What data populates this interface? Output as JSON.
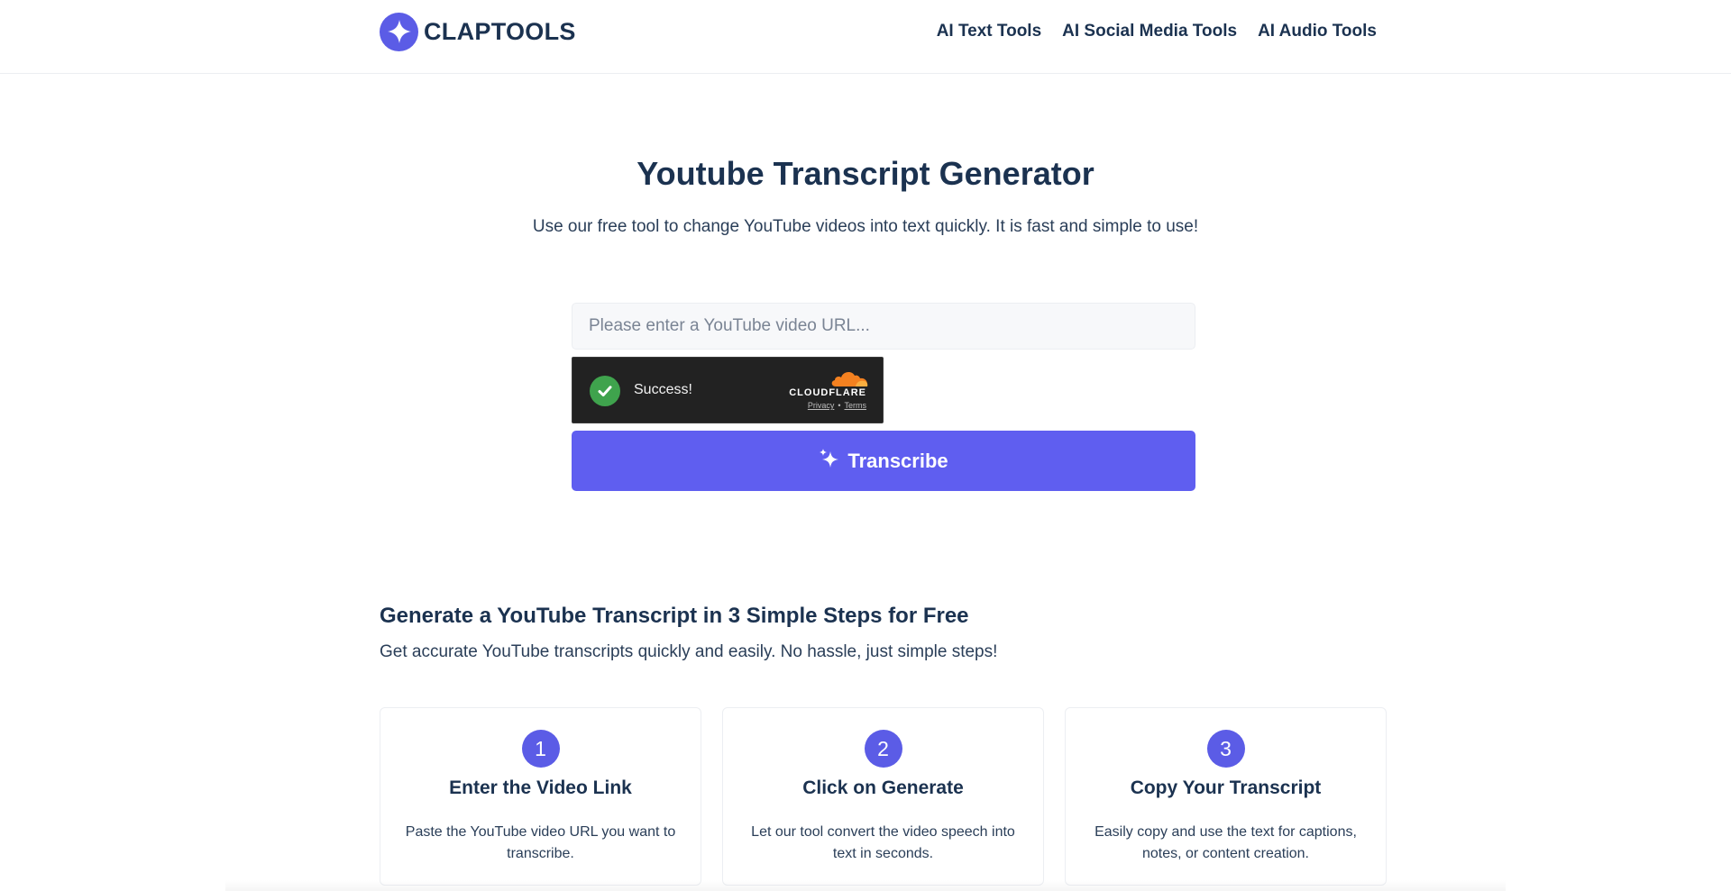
{
  "brand": {
    "name": "CLAPTOOLS",
    "logo_icon": "sparkle-icon",
    "color": "#5b5ce6"
  },
  "nav": {
    "items": [
      {
        "label": "AI Text Tools"
      },
      {
        "label": "AI Social Media Tools"
      },
      {
        "label": "AI Audio Tools"
      }
    ]
  },
  "hero": {
    "title": "Youtube Transcript Generator",
    "subtitle": "Use our free tool to change YouTube videos into text quickly. It is fast and simple to use!"
  },
  "form": {
    "url_value": "",
    "url_placeholder": "Please enter a YouTube video URL...",
    "captcha": {
      "status": "Success!",
      "brand": "CLOUDFLARE",
      "privacy": "Privacy",
      "separator": "•",
      "terms": "Terms"
    },
    "submit_label": "Transcribe",
    "submit_icon": "sparkles-icon",
    "accent_color": "#5f5ef0"
  },
  "steps": {
    "title": "Generate a YouTube Transcript in 3 Simple Steps for Free",
    "subtitle": "Get accurate YouTube transcripts quickly and easily. No hassle, just simple steps!",
    "items": [
      {
        "number": "1",
        "title": "Enter the Video Link",
        "desc": "Paste the YouTube video URL you want to transcribe."
      },
      {
        "number": "2",
        "title": "Click on Generate",
        "desc": "Let our tool convert the video speech into text in seconds."
      },
      {
        "number": "3",
        "title": "Copy Your Transcript",
        "desc": "Easily copy and use the text for captions, notes, or content creation."
      }
    ]
  }
}
